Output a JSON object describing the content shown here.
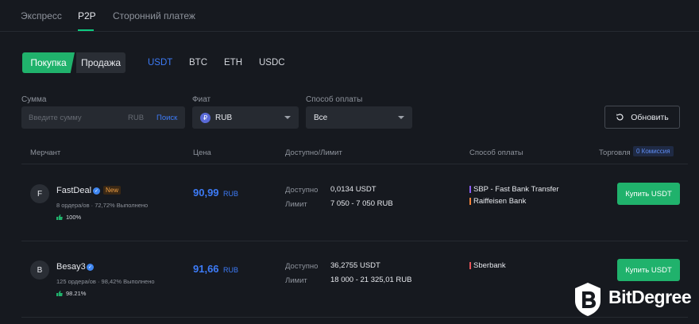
{
  "tabs": [
    {
      "label": "Экспресс",
      "active": false
    },
    {
      "label": "P2P",
      "active": true
    },
    {
      "label": "Сторонний платеж",
      "active": false
    }
  ],
  "trade_type": {
    "buy_label": "Покупка",
    "sell_label": "Продажа"
  },
  "coins": [
    "USDT",
    "BTC",
    "ETH",
    "USDC"
  ],
  "filters": {
    "amount_label": "Сумма",
    "amount_placeholder": "Введите сумму",
    "amount_currency": "RUB",
    "search_label": "Поиск",
    "fiat_label": "Фиат",
    "fiat_value": "RUB",
    "fiat_icon_text": "₽",
    "payment_label": "Способ оплаты",
    "payment_value": "Все",
    "refresh_label": "Обновить"
  },
  "table": {
    "headers": {
      "merchant": "Мерчант",
      "price": "Цена",
      "available_limit": "Доступно/Лимит",
      "payment_method": "Способ оплаты",
      "trading": "Торговля",
      "fee_badge": "0 Комиссия"
    },
    "rows": [
      {
        "initial": "F",
        "name": "FastDeal",
        "badge": "New",
        "stats": "8 ордера/ов · 72,72% Выполнено",
        "rating": "100%",
        "price": "90,99",
        "price_currency": "RUB",
        "available_label": "Доступно",
        "available_value": "0,0134 USDT",
        "limit_label": "Лимит",
        "limit_value": "7 050 - 7 050 RUB",
        "payment_methods": [
          {
            "name": "SBP - Fast Bank Transfer",
            "color": "#8a5cf5"
          },
          {
            "name": "Raiffeisen Bank",
            "color": "#f0833a"
          }
        ],
        "action": "Купить USDT"
      },
      {
        "initial": "B",
        "name": "Besay3",
        "badge": "",
        "stats": "125 ордера/ов · 98,42% Выполнено",
        "rating": "98.21%",
        "price": "91,66",
        "price_currency": "RUB",
        "available_label": "Доступно",
        "available_value": "36,2755 USDT",
        "limit_label": "Лимит",
        "limit_value": "18 000 - 21 325,01 RUB",
        "payment_methods": [
          {
            "name": "Sberbank",
            "color": "#e8545a"
          }
        ],
        "action": "Купить USDT"
      }
    ]
  },
  "watermark": {
    "brand": "BitDegree"
  },
  "colors": {
    "accent_green": "#20b26c",
    "accent_blue": "#3d7bf7",
    "background": "#16191f"
  }
}
